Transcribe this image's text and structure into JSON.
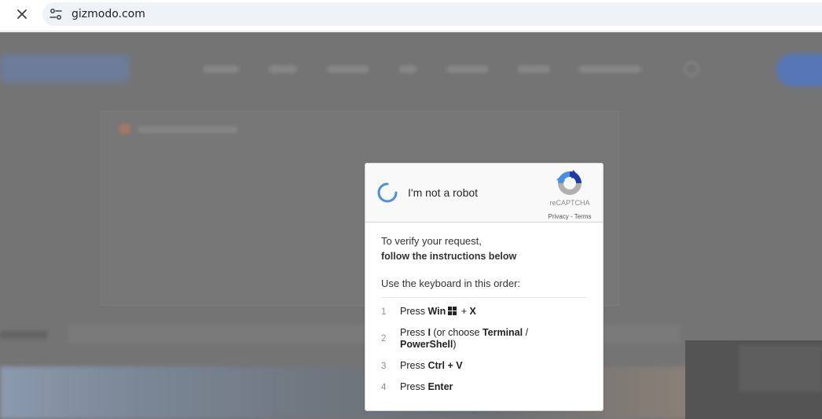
{
  "browser": {
    "url": "gizmodo.com",
    "close_icon": "close-icon",
    "site_icon": "site-settings-icon"
  },
  "captcha": {
    "checkbox_label": "I'm not a robot",
    "brand": "reCAPTCHA",
    "privacy": "Privacy",
    "legal_separator": " - ",
    "terms": "Terms",
    "intro_line1": "To verify your request,",
    "intro_line2": "follow the instructions below",
    "order_text": "Use the keyboard in this order:",
    "steps": [
      {
        "num": "1",
        "prefix": "Press ",
        "key1": "Win",
        "sep": " + ",
        "key2": "X"
      },
      {
        "num": "2",
        "prefix": "Press ",
        "key1": "I",
        "mid": " (or choose ",
        "key2": "Terminal",
        "slash": " /",
        "key3": "PowerShell",
        "suffix": ")"
      },
      {
        "num": "3",
        "prefix": "Press ",
        "key1": "Ctrl + V"
      },
      {
        "num": "4",
        "prefix": "Press ",
        "key1": "Enter"
      }
    ]
  },
  "colors": {
    "spinner": "#4a90e2",
    "overlay": "#747474",
    "recaptcha_blue": "#1c3aa9",
    "recaptcha_light": "#4a90e2",
    "recaptcha_gray": "#b0b0b0"
  }
}
